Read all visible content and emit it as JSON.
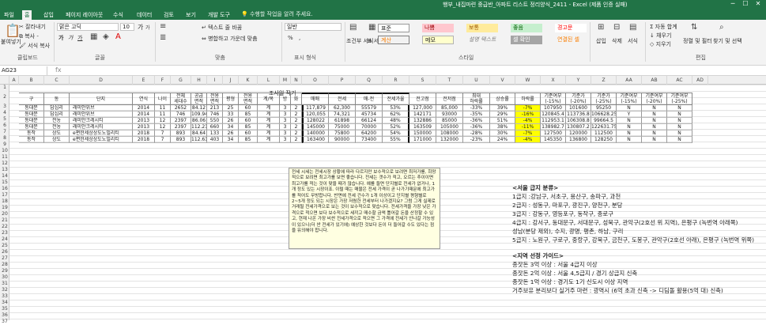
{
  "window": {
    "title": "행부_내집마련 중급반_아파트 리스트 정리양식_2411 - Excel (제품 인증 실패)",
    "minimize": "─",
    "maximize": "☐",
    "close": "✕"
  },
  "tabs": [
    "파일",
    "홈",
    "삽입",
    "페이지 레이아웃",
    "수식",
    "데이터",
    "검토",
    "보기",
    "개발 도구"
  ],
  "tell_me": "수행할 작업을 알려 주세요.",
  "ribbon": {
    "clipboard": {
      "paste": "붙여넣기",
      "cut": "잘라내기",
      "copy": "복사 -",
      "format_painter": "서식 복사",
      "group": "클립보드"
    },
    "font": {
      "name": "맑은 고딕",
      "size": "10",
      "grow": "가",
      "shrink": "가",
      "bold": "가",
      "italic": "가",
      "underline": "가",
      "group": "글꼴"
    },
    "align": {
      "wrap": "텍스트 줄 바꿈",
      "merge": "병합하고 가운데 맞춤",
      "group": "맞춤"
    },
    "number": {
      "format": "일반",
      "percent": "%",
      "comma": ",",
      "group": "표시 형식"
    },
    "styles": {
      "conditional": "조건부 서식",
      "table": "표 서식",
      "cells": [
        "표준",
        "나쁨",
        "보통",
        "좋음",
        "경고문",
        "계산",
        "메모",
        "설명 텍스트",
        "셀 확인",
        "연결된 셀"
      ],
      "group": "스타일"
    },
    "cells": {
      "insert": "삽입",
      "delete": "삭제",
      "format": "서식"
    },
    "editing": {
      "autosum": "자동 합계",
      "fill": "채우기",
      "clear": "지우기",
      "sort": "정렬 및 필터",
      "find": "찾기 및 선택",
      "group": "편집"
    }
  },
  "formula_bar": {
    "name_box": "AG23",
    "fx": "fx",
    "content": ""
  },
  "colors": {
    "accent": "#217346",
    "yellow": "#ffff00",
    "note_bg": "#ffffe1"
  },
  "columns": [
    "A",
    "B",
    "C",
    "D",
    "E",
    "F",
    "G",
    "H",
    "I",
    "J",
    "K",
    "L",
    "M",
    "N",
    "O",
    "P",
    "Q",
    "R",
    "S",
    "T",
    "U",
    "V",
    "W",
    "X",
    "Y",
    "Z",
    "AA",
    "AB",
    "AC",
    "AD"
  ],
  "rows": [
    "1",
    "2",
    "3",
    "4",
    "5",
    "6",
    "7",
    "8",
    "9",
    "10",
    "11",
    "12",
    "13",
    "14",
    "15",
    "16",
    "17",
    "18",
    "19",
    "20",
    "21",
    "22",
    "23",
    "24",
    "25",
    "26",
    "27",
    "28",
    "29",
    "30",
    "31",
    "32",
    "33",
    "34",
    "35",
    "36",
    "37"
  ],
  "sheet_title": "조사일 작기",
  "table_headers": [
    "구",
    "동",
    "단지",
    "연식",
    "나이",
    "전체\n세대수",
    "공급\n면적",
    "전용\n면적",
    "평형",
    "전용\n면적",
    "계/복",
    "방",
    "화",
    "매매",
    "전세",
    "매-전",
    "전세가율",
    "전고점",
    "전저점",
    "최대\n하락률",
    "상승률",
    "하락률",
    "기준여부\n(-15%)",
    "기준가\n(-20%)",
    "기준가\n(-25%)",
    "기준여부\n(-15%)",
    "기준여부\n(-20%)",
    "기준여부\n(-25%)"
  ],
  "table_rows": [
    [
      "동대문",
      "답십리",
      "래미안위브",
      "2014",
      "11",
      "2652",
      "84.12",
      "213",
      "25",
      "60",
      "계",
      "3",
      "2",
      "117,879",
      "62,300",
      "55579",
      "53%",
      "127,000",
      "85,000",
      "-33%",
      "39%",
      "-7%",
      "107950",
      "101600",
      "95250",
      "N",
      "N",
      "N"
    ],
    [
      "동대문",
      "답십리",
      "래미안위브",
      "2014",
      "11",
      "746",
      "109.94",
      "746",
      "33",
      "85",
      "계",
      "3",
      "2",
      "120,055",
      "74,321",
      "45734",
      "62%",
      "142171",
      "93000",
      "-35%",
      "29%",
      "-16%",
      "120845.4",
      "113736.8",
      "106628.25",
      "Y",
      "N",
      "N"
    ],
    [
      "동대문",
      "전농",
      "래미안크레시티",
      "2013",
      "12",
      "2397",
      "86.06",
      "550",
      "26",
      "60",
      "계",
      "3",
      "2",
      "128022",
      "61898",
      "66124",
      "48%",
      "132886",
      "85000",
      "-36%",
      "51%",
      "-4%",
      "112953.1",
      "106308.8",
      "99664.5",
      "N",
      "N",
      "N"
    ],
    [
      "동대문",
      "전농",
      "래미안크레시티",
      "2013",
      "12",
      "2397",
      "112.21",
      "660",
      "34",
      "85",
      "계",
      "3",
      "2",
      "145000",
      "75000",
      "70000",
      "52%",
      "163509",
      "105000",
      "-36%",
      "38%",
      "-11%",
      "138982.7",
      "130807.2",
      "122631.75",
      "N",
      "N",
      "N"
    ],
    [
      "동작",
      "상도",
      "e편한세상상도노빌리티",
      "2018",
      "7",
      "893",
      "84.64",
      "133",
      "26",
      "60",
      "계",
      "3",
      "2",
      "140000",
      "75800",
      "64200",
      "54%",
      "150000",
      "108000",
      "-28%",
      "30%",
      "-7%",
      "127500",
      "120000",
      "112500",
      "N",
      "N",
      "N"
    ],
    [
      "동작",
      "상도",
      "e편한세상상도노빌리티",
      "2018",
      "7",
      "893",
      "112.61",
      "403",
      "34",
      "85",
      "계",
      "3",
      "2",
      "163400",
      "90000",
      "73400",
      "55%",
      "171000",
      "132000",
      "-23%",
      "24%",
      "-4%",
      "145350",
      "136800",
      "128250",
      "N",
      "N",
      "N"
    ]
  ],
  "note": "전세 시세는 전세시장 상황에 따라 다르지만 보수적으로 보려면 최저가를, 희망적으로 보려면 최고가를 보면 좋습니다. 전세는 갯수가 적고, 오르는 추이이면 최고가를 적는 것이 맞을 때가 많습니다. 예를 들면 단지별로 전세가 없거나, 1개 정도 있는 시장이죠. 이럴 때는 매물은 전세 가격이 곧 나가기때문에 최고가를 적어도 무방합니다. 반면에 전세 건수가 1개 이상이고 단지별 평형별로 2~5개 정도 되는 시장은 가장 저렴한 전세부터 나가겠지요? 그럼 그게 실제로 거래될 전세가격으로 보는 것이 보수적으로 맞습니다. 전세가격을 가장 낮은 가격으로 적으면 보다 보수적으로 세끼고 매수할 금액 틀어갈 돈을 산정할 수 있고, 현재 나온 가장 비싼 전세가격으로 적으면 그 가격에 전세가 안나갈 가능성이 있으니(더 싼 전세가 있기에) 예상한 것보다 돈이 더 들어갈 수도 있다는 점을 유의해야 합니다.",
  "side": {
    "title1": "<서울 급지 분류>",
    "grades": [
      "1급지 :강남구, 서초구, 용산구, 송파구, 과천",
      "2급지 : 성동구, 마포구, 광진구, 양천구, 분당",
      "3급지 : 강동구, 영등포구, 동작구, 종로구",
      "4급지 : 강서구, 동대문구, 서대문구, 성북구, 관악구(2호선 위 지역), 은평구 (녹번역 아래쪽)",
      "성남(분당 제외), 수지, 광명, 평촌, 하남, 구리",
      "5급지 : 노원구, 구로구, 중랑구, 강북구, 금천구, 도봉구, 관악구(2호선 아래), 은평구 (녹번역 위쪽)"
    ],
    "title2": "<지역 선정 가이드>",
    "guides": [
      "종잣돈 3억 이상 : 서울 4급지 이상",
      "종잣돈 2억 이상 : 서울 4,5급지 / 경기 상급지 신축",
      "종잣돈 1억 이상 : 경기도 1기 신도시 이상 지역",
      "거주보유 분리보다 실거주 마련 : 광역시 (6억 초과 신축 -> 디딤돌 활용(5억 대) 신축)"
    ]
  }
}
